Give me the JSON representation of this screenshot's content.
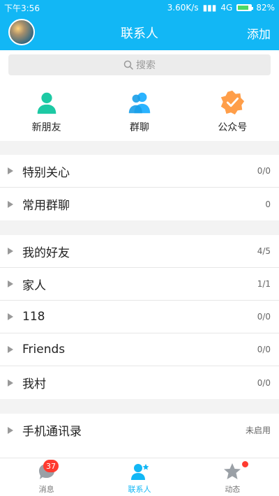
{
  "status_bar": {
    "time": "下午3:56",
    "speed": "3.60K/s",
    "network": "4G",
    "battery": "82%",
    "battery_level": 0.82
  },
  "header": {
    "title": "联系人",
    "action": "添加"
  },
  "search": {
    "placeholder": "搜索"
  },
  "quick_actions": [
    {
      "label": "新朋友",
      "icon": "person-icon",
      "color": "#1dc9a4"
    },
    {
      "label": "群聊",
      "icon": "group-icon",
      "color": "#2bb3ff"
    },
    {
      "label": "公众号",
      "icon": "verified-badge-icon",
      "color": "#ff9e49"
    }
  ],
  "groups_1": [
    {
      "name": "特别关心",
      "count": "0/0"
    },
    {
      "name": "常用群聊",
      "count": "0"
    }
  ],
  "groups_2": [
    {
      "name": "我的好友",
      "count": "4/5"
    },
    {
      "name": "家人",
      "count": "1/1"
    },
    {
      "name": "118",
      "count": "0/0"
    },
    {
      "name": "Friends",
      "count": "0/0"
    },
    {
      "name": "我村",
      "count": "0/0"
    }
  ],
  "groups_3": [
    {
      "name": "手机通讯录",
      "count": "未启用"
    }
  ],
  "bottom_nav": {
    "items": [
      {
        "label": "消息",
        "badge": "37"
      },
      {
        "label": "联系人"
      },
      {
        "label": "动态"
      }
    ]
  },
  "colors": {
    "accent": "#12b7f5",
    "badge": "#ff3b30"
  }
}
